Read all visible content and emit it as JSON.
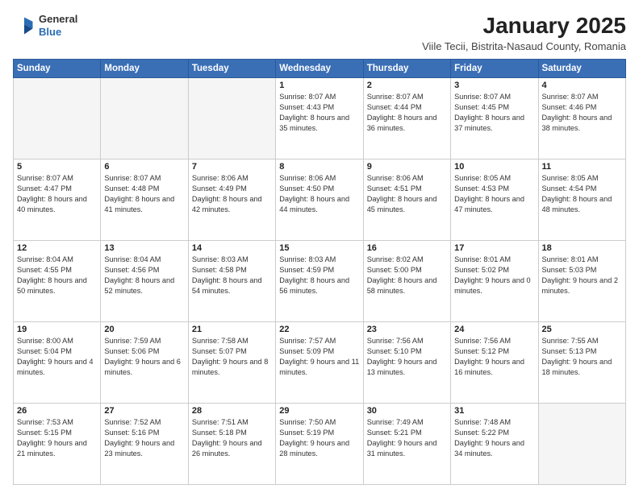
{
  "header": {
    "logo_general": "General",
    "logo_blue": "Blue",
    "main_title": "January 2025",
    "subtitle": "Viile Tecii, Bistrita-Nasaud County, Romania"
  },
  "weekdays": [
    "Sunday",
    "Monday",
    "Tuesday",
    "Wednesday",
    "Thursday",
    "Friday",
    "Saturday"
  ],
  "weeks": [
    [
      {
        "day": "",
        "empty": true
      },
      {
        "day": "",
        "empty": true
      },
      {
        "day": "",
        "empty": true
      },
      {
        "day": "1",
        "sunrise": "8:07 AM",
        "sunset": "4:43 PM",
        "daylight": "8 hours and 35 minutes."
      },
      {
        "day": "2",
        "sunrise": "8:07 AM",
        "sunset": "4:44 PM",
        "daylight": "8 hours and 36 minutes."
      },
      {
        "day": "3",
        "sunrise": "8:07 AM",
        "sunset": "4:45 PM",
        "daylight": "8 hours and 37 minutes."
      },
      {
        "day": "4",
        "sunrise": "8:07 AM",
        "sunset": "4:46 PM",
        "daylight": "8 hours and 38 minutes."
      }
    ],
    [
      {
        "day": "5",
        "sunrise": "8:07 AM",
        "sunset": "4:47 PM",
        "daylight": "8 hours and 40 minutes."
      },
      {
        "day": "6",
        "sunrise": "8:07 AM",
        "sunset": "4:48 PM",
        "daylight": "8 hours and 41 minutes."
      },
      {
        "day": "7",
        "sunrise": "8:06 AM",
        "sunset": "4:49 PM",
        "daylight": "8 hours and 42 minutes."
      },
      {
        "day": "8",
        "sunrise": "8:06 AM",
        "sunset": "4:50 PM",
        "daylight": "8 hours and 44 minutes."
      },
      {
        "day": "9",
        "sunrise": "8:06 AM",
        "sunset": "4:51 PM",
        "daylight": "8 hours and 45 minutes."
      },
      {
        "day": "10",
        "sunrise": "8:05 AM",
        "sunset": "4:53 PM",
        "daylight": "8 hours and 47 minutes."
      },
      {
        "day": "11",
        "sunrise": "8:05 AM",
        "sunset": "4:54 PM",
        "daylight": "8 hours and 48 minutes."
      }
    ],
    [
      {
        "day": "12",
        "sunrise": "8:04 AM",
        "sunset": "4:55 PM",
        "daylight": "8 hours and 50 minutes."
      },
      {
        "day": "13",
        "sunrise": "8:04 AM",
        "sunset": "4:56 PM",
        "daylight": "8 hours and 52 minutes."
      },
      {
        "day": "14",
        "sunrise": "8:03 AM",
        "sunset": "4:58 PM",
        "daylight": "8 hours and 54 minutes."
      },
      {
        "day": "15",
        "sunrise": "8:03 AM",
        "sunset": "4:59 PM",
        "daylight": "8 hours and 56 minutes."
      },
      {
        "day": "16",
        "sunrise": "8:02 AM",
        "sunset": "5:00 PM",
        "daylight": "8 hours and 58 minutes."
      },
      {
        "day": "17",
        "sunrise": "8:01 AM",
        "sunset": "5:02 PM",
        "daylight": "9 hours and 0 minutes."
      },
      {
        "day": "18",
        "sunrise": "8:01 AM",
        "sunset": "5:03 PM",
        "daylight": "9 hours and 2 minutes."
      }
    ],
    [
      {
        "day": "19",
        "sunrise": "8:00 AM",
        "sunset": "5:04 PM",
        "daylight": "9 hours and 4 minutes."
      },
      {
        "day": "20",
        "sunrise": "7:59 AM",
        "sunset": "5:06 PM",
        "daylight": "9 hours and 6 minutes."
      },
      {
        "day": "21",
        "sunrise": "7:58 AM",
        "sunset": "5:07 PM",
        "daylight": "9 hours and 8 minutes."
      },
      {
        "day": "22",
        "sunrise": "7:57 AM",
        "sunset": "5:09 PM",
        "daylight": "9 hours and 11 minutes."
      },
      {
        "day": "23",
        "sunrise": "7:56 AM",
        "sunset": "5:10 PM",
        "daylight": "9 hours and 13 minutes."
      },
      {
        "day": "24",
        "sunrise": "7:56 AM",
        "sunset": "5:12 PM",
        "daylight": "9 hours and 16 minutes."
      },
      {
        "day": "25",
        "sunrise": "7:55 AM",
        "sunset": "5:13 PM",
        "daylight": "9 hours and 18 minutes."
      }
    ],
    [
      {
        "day": "26",
        "sunrise": "7:53 AM",
        "sunset": "5:15 PM",
        "daylight": "9 hours and 21 minutes."
      },
      {
        "day": "27",
        "sunrise": "7:52 AM",
        "sunset": "5:16 PM",
        "daylight": "9 hours and 23 minutes."
      },
      {
        "day": "28",
        "sunrise": "7:51 AM",
        "sunset": "5:18 PM",
        "daylight": "9 hours and 26 minutes."
      },
      {
        "day": "29",
        "sunrise": "7:50 AM",
        "sunset": "5:19 PM",
        "daylight": "9 hours and 28 minutes."
      },
      {
        "day": "30",
        "sunrise": "7:49 AM",
        "sunset": "5:21 PM",
        "daylight": "9 hours and 31 minutes."
      },
      {
        "day": "31",
        "sunrise": "7:48 AM",
        "sunset": "5:22 PM",
        "daylight": "9 hours and 34 minutes."
      },
      {
        "day": "",
        "empty": true
      }
    ]
  ]
}
